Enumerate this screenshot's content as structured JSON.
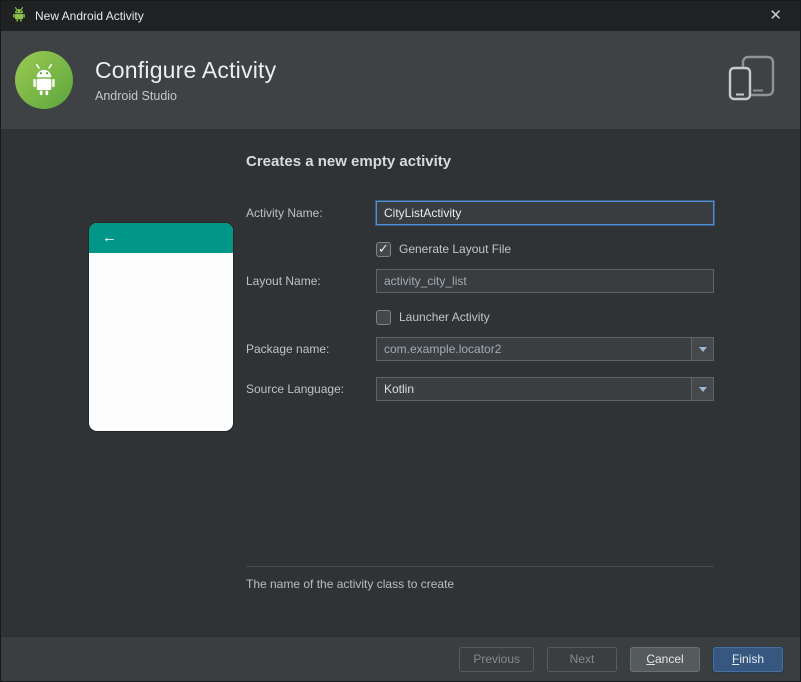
{
  "window": {
    "title": "New Android Activity",
    "close_glyph": "✕"
  },
  "header": {
    "title": "Configure Activity",
    "subtitle": "Android Studio"
  },
  "content": {
    "heading": "Creates a new empty activity",
    "preview": {
      "back_arrow": "←"
    },
    "fields": {
      "activity_name_label": "Activity Name:",
      "activity_name_value": "CityListActivity",
      "generate_layout_label": "Generate Layout File",
      "layout_name_label": "Layout Name:",
      "layout_name_value": "activity_city_list",
      "launcher_label": "Launcher Activity",
      "package_label": "Package name:",
      "package_value": "com.example.locator2",
      "language_label": "Source Language:",
      "language_value": "Kotlin"
    },
    "help_text": "The name of the activity class to create"
  },
  "footer": {
    "previous": "Previous",
    "next": "Next",
    "cancel_mnemonic": "C",
    "cancel_rest": "ancel",
    "finish_mnemonic": "F",
    "finish_rest": "inish"
  },
  "checkbox_states": {
    "generate_layout": true,
    "launcher": false
  },
  "colors": {
    "accent_teal": "#009688",
    "finish_button": "#365880",
    "focus_border": "#4E8ED8",
    "android_green": "#8AC34A"
  }
}
